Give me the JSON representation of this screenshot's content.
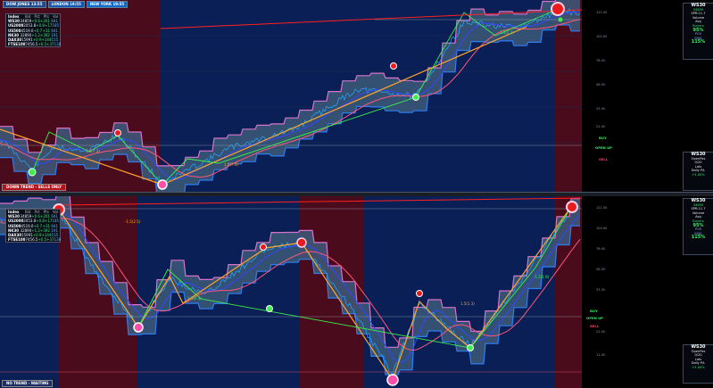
{
  "sessions": {
    "ny_label": "DOW JONES 13:55",
    "london_label": "LONDON 19:55",
    "newyork_label": "NEW YORK 19:55"
  },
  "top_pane": {
    "status": "DOWN TREND - SELLS ONLY",
    "signals": {
      "buy": "BUY",
      "open": "OPEN UP",
      "sell": "SELL"
    },
    "annotations": [
      "1.5(7.3)",
      "1.5(7.3)",
      "1.5(2.2)"
    ],
    "price_ticks": [
      "121.50",
      "100.00",
      "78.00",
      "56.50",
      "33.50",
      "22.00"
    ],
    "table": {
      "header": [
        "Index",
        "Bid",
        "Pct",
        "Pts",
        "Vol"
      ],
      "rows": [
        [
          "WS30",
          "34859",
          "+0.6",
          "+201",
          "641"
        ],
        [
          "US2000",
          "2053.8",
          "+0.8",
          "+17",
          "185"
        ],
        [
          "US500",
          "4519.0",
          "+0.7",
          "+31",
          "641"
        ],
        [
          "NK30",
          "32890",
          "+1.2",
          "+392",
          "191"
        ],
        [
          "DAX30",
          "15991",
          "+0.9",
          "+144",
          "155"
        ],
        [
          "FTSE100",
          "7456.5",
          "+0.5",
          "+37",
          "138"
        ]
      ]
    },
    "panel_a": {
      "symbol": "WS30",
      "price": "34859",
      "spread": "SPR:11.7",
      "lines": [
        "Volume",
        "Avg",
        "Buyers",
        "Sellers"
      ],
      "big": "95%",
      "small": [
        "POS",
        "RISK",
        "R:R"
      ],
      "big2": "115%"
    },
    "panel_b": {
      "symbol": "WS30",
      "lines": [
        "OpenPos",
        "0/20",
        "Lots",
        "Daily P/L"
      ],
      "pct": "+5.00%"
    }
  },
  "bottom_pane": {
    "status": "NO TREND - WAITING",
    "signals": {
      "buy": "BUY",
      "open": "OPEN UP",
      "sell": "SELL"
    },
    "annotations": [
      "-1.5(2.5)",
      "1.5(0.3)",
      "1.5(1.3)",
      "-1.5(1.9)"
    ],
    "price_ticks": [
      "121.50",
      "100.00",
      "78.00",
      "56.50",
      "33.50",
      "22.00",
      "11.00"
    ],
    "table": {
      "header": [
        "Index",
        "Bid",
        "Pct",
        "Pts",
        "Vol"
      ],
      "rows": [
        [
          "WS30",
          "34859",
          "+0.6",
          "+201",
          "641"
        ],
        [
          "US2000",
          "2053.8",
          "+0.8",
          "+17",
          "185"
        ],
        [
          "US500",
          "4519.0",
          "+0.7",
          "+31",
          "641"
        ],
        [
          "NK30",
          "32890",
          "+1.2",
          "+392",
          "191"
        ],
        [
          "DAX30",
          "15991",
          "+0.9",
          "+144",
          "155"
        ],
        [
          "FTSE100",
          "7456.5",
          "+0.5",
          "+37",
          "138"
        ]
      ]
    },
    "panel_a": {
      "symbol": "WS30",
      "price": "34859",
      "spread": "SPR:11.7",
      "lines": [
        "Volume",
        "Avg",
        "Buyers",
        "Sellers"
      ],
      "big": "95%",
      "small": [
        "POS",
        "RISK",
        "R:R"
      ],
      "big2": "115%"
    },
    "panel_b": {
      "symbol": "WS30",
      "lines": [
        "OpenPos",
        "0/20",
        "Lots",
        "Daily P/L"
      ],
      "pct": "+5.00%"
    }
  },
  "colors": {
    "bg_blue": "#0a1f55",
    "bg_red": "#4a0c1c",
    "band_fill": "#3c5a7a",
    "band_edge_hi": "#d873c9",
    "band_edge_lo": "#2e7df0",
    "price_up": "#22aaff",
    "price_dn": "#e47ad8",
    "trend": "#ffa52a",
    "zig": "#3bf04a"
  }
}
